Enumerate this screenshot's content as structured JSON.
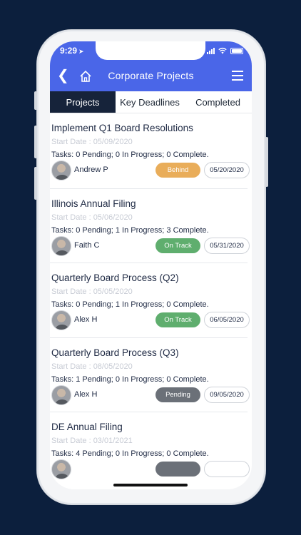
{
  "status_bar": {
    "time": "9:29"
  },
  "app_bar": {
    "title": "Corporate Projects"
  },
  "tabs": [
    {
      "label": "Projects",
      "active": true
    },
    {
      "label": "Key Deadlines",
      "active": false
    },
    {
      "label": "Completed",
      "active": false
    }
  ],
  "projects": [
    {
      "title": "Implement Q1 Board Resolutions",
      "start": "Start Date : 05/09/2020",
      "tasks": "Tasks: 0 Pending; 0 In Progress; 0 Complete.",
      "owner": "Andrew P",
      "status": "Behind",
      "status_color": "#e9ad5a",
      "due": "05/20/2020"
    },
    {
      "title": "Illinois Annual Filing",
      "start": "Start Date : 05/06/2020",
      "tasks": "Tasks: 0 Pending; 1 In Progress; 3 Complete.",
      "owner": "Faith C",
      "status": "On Track",
      "status_color": "#5fae6e",
      "due": "05/31/2020"
    },
    {
      "title": "Quarterly Board Process (Q2)",
      "start": "Start Date : 05/05/2020",
      "tasks": "Tasks: 0 Pending; 1 In Progress; 0 Complete.",
      "owner": "Alex H",
      "status": "On Track",
      "status_color": "#5fae6e",
      "due": "06/05/2020"
    },
    {
      "title": "Quarterly Board Process (Q3)",
      "start": "Start Date : 08/05/2020",
      "tasks": "Tasks: 1 Pending; 0 In Progress; 0 Complete.",
      "owner": "Alex H",
      "status": "Pending",
      "status_color": "#6b7078",
      "due": "09/05/2020"
    },
    {
      "title": "DE Annual Filing",
      "start": "Start Date : 03/01/2021",
      "tasks": "Tasks: 4 Pending; 0 In Progress; 0 Complete.",
      "owner": "",
      "status": "",
      "status_color": "#6b7078",
      "due": ""
    }
  ],
  "colors": {
    "accent": "#4a66e8",
    "tab_active": "#16233a",
    "background": "#0c1f3d"
  }
}
